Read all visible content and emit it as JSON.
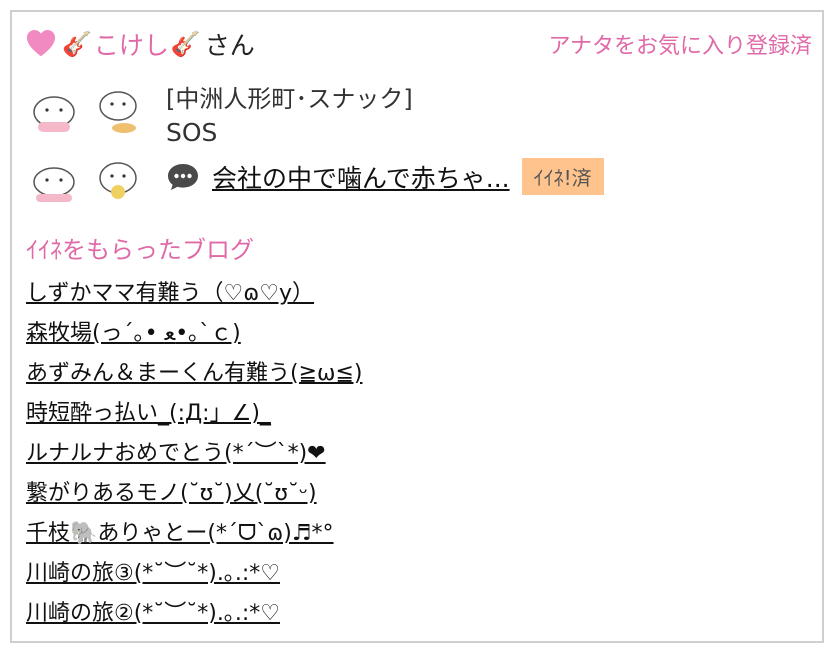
{
  "user": {
    "name": "こけし",
    "suffix": "さん",
    "heart_icon": "heart-icon",
    "guitar_icon": "guitar-icon",
    "accent_color": "#e06aa8"
  },
  "favorite_label": "アナタをお気に入り登録済",
  "shop": {
    "area": "[中洲人形町･スナック]",
    "name": "SOS"
  },
  "latest": {
    "icon": "speech-bubble-icon",
    "title": "会社の中で噛んで赤ちゃ...",
    "badge": "ｲｲﾈ!済",
    "badge_color": "#ffc48d"
  },
  "section_title": "ｲｲﾈをもらったブログ",
  "blogs": [
    "しずかママ有難う（♡ɷ♡y）",
    "森牧場(っ´｡• ﻌ•｡`ｃ)",
    "あずみん＆まーくん有難う(≧ω≦)",
    "時短酔っ払い_(:Д:」∠)_",
    "ルナルナおめでとう(*´︶`*)❤",
    "繋がりあるモノ(˘ʊ˘)乂(˘ʊ˘ᵕ)",
    "千枝🐘ありゃとー(*´ᗜ`ɷ)♬*°",
    "川崎の旅③(*˘︶˘*).｡.:*♡",
    "川崎の旅②(*˘︶˘*).｡.:*♡"
  ]
}
